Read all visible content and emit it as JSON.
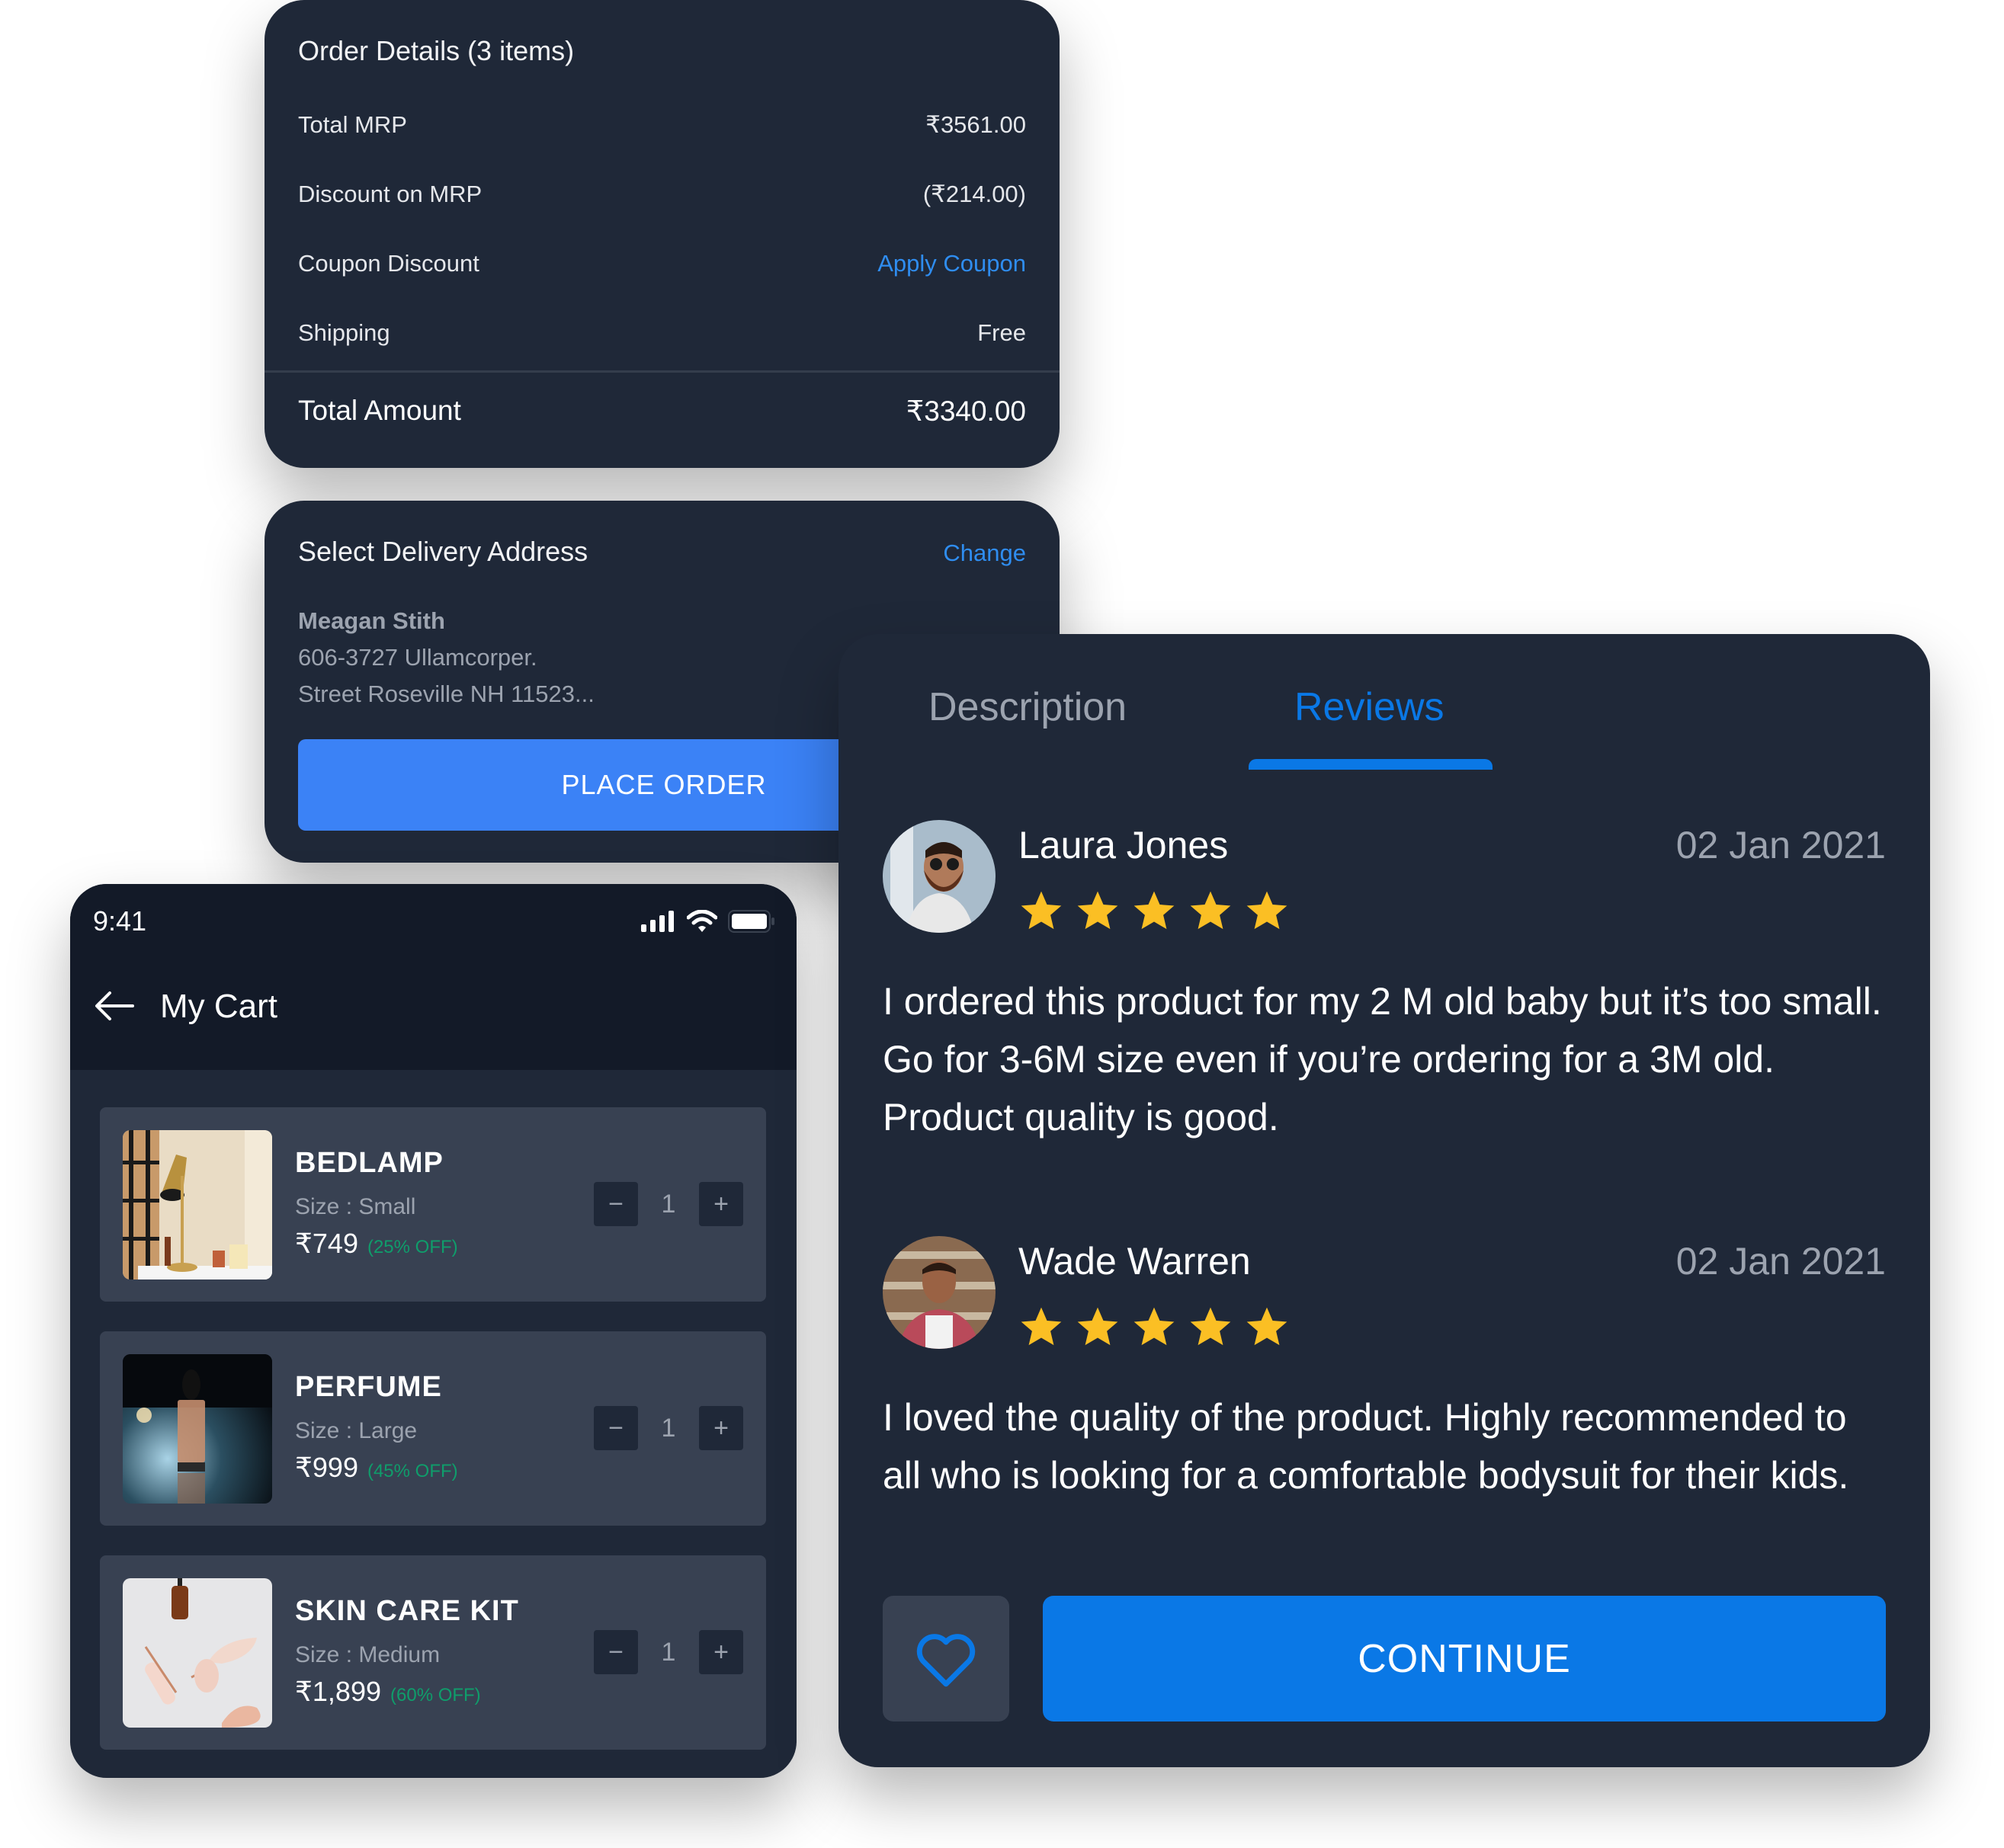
{
  "order_details": {
    "title": "Order Details (3 items)",
    "rows": [
      {
        "label": "Total MRP",
        "value": "₹3561.00"
      },
      {
        "label": "Discount on MRP",
        "value": "(₹214.00)"
      },
      {
        "label": "Coupon Discount",
        "value": "Apply Coupon"
      },
      {
        "label": "Shipping",
        "value": "Free"
      }
    ],
    "total_label": "Total Amount",
    "total_value": "₹3340.00"
  },
  "delivery": {
    "title": "Select Delivery Address",
    "change_label": "Change",
    "name": "Meagan Stith",
    "address_line1": "606-3727 Ullamcorper.",
    "address_line2": "Street Roseville NH 11523...",
    "place_order_label": "PLACE ORDER"
  },
  "cart": {
    "status_time": "9:41",
    "status_icons": [
      "signal-icon",
      "wifi-icon",
      "battery-icon"
    ],
    "title": "My Cart",
    "items": [
      {
        "name": "BEDLAMP",
        "size": "Size : Small",
        "price": "₹749",
        "discount": "(25% OFF)",
        "quantity": "1"
      },
      {
        "name": "PERFUME",
        "size": "Size : Large",
        "price": "₹999",
        "discount": "(45% OFF)",
        "quantity": "1"
      },
      {
        "name": "SKIN CARE KIT",
        "size": "Size : Medium",
        "price": "₹1,899",
        "discount": "(60% OFF)",
        "quantity": "1"
      }
    ],
    "decrement_symbol": "−",
    "increment_symbol": "+"
  },
  "product_tabs": {
    "tabs": [
      {
        "label": "Description",
        "active": false
      },
      {
        "label": "Reviews",
        "active": true
      }
    ]
  },
  "reviews": [
    {
      "name": "Laura Jones",
      "date": "02 Jan 2021",
      "rating": 5,
      "text": "I ordered this product for my 2 M old baby but it’s too small. Go for 3-6M size even if you’re ordering for a 3M old. Product quality is good."
    },
    {
      "name": "Wade Warren",
      "date": "02 Jan 2021",
      "rating": 5,
      "text": "I loved the quality of the product. Highly recommended to all who is looking for a comfortable bodysuit for their kids."
    }
  ],
  "actions": {
    "favorite_icon": "heart-icon",
    "continue_label": "CONTINUE"
  },
  "colors": {
    "card_bg": "#1f2838",
    "accent_blue": "#0a78e6",
    "link_blue": "#2f8df0",
    "place_order_blue": "#3b82f6",
    "discount_green": "#0f9d6b",
    "star_yellow": "#fbbf24",
    "muted_text": "#9ca3af"
  }
}
